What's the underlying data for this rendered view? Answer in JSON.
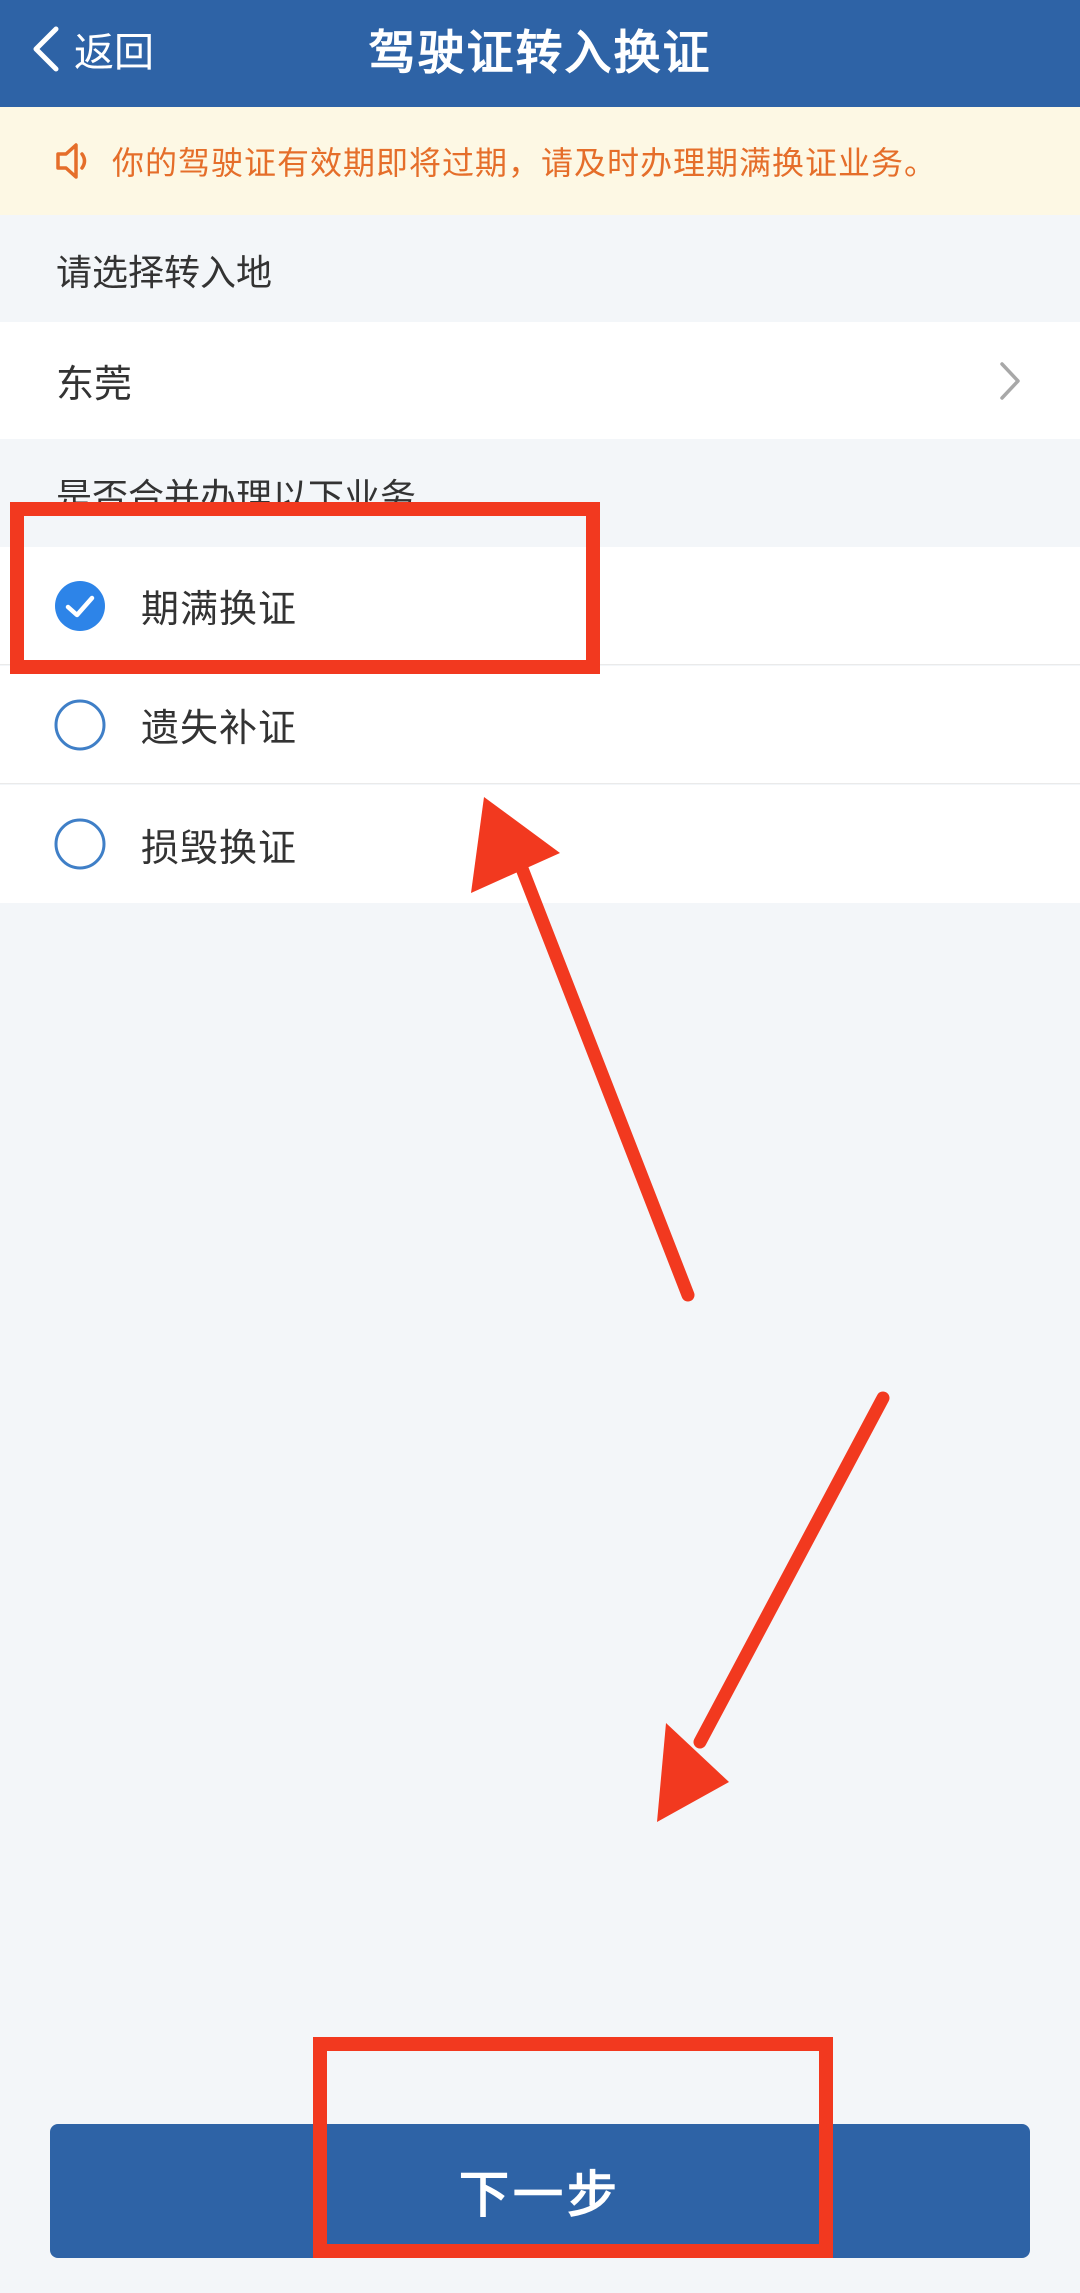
{
  "header": {
    "back_label": "返回",
    "title": "驾驶证转入换证"
  },
  "notice": {
    "icon": "speaker-icon",
    "text": "你的驾驶证有效期即将过期，请及时办理期满换证业务。"
  },
  "transfer": {
    "section_label": "请选择转入地",
    "selected_city": "东莞"
  },
  "services": {
    "section_label": "是否合并办理以下业务",
    "options": [
      {
        "label": "期满换证",
        "checked": true
      },
      {
        "label": "遗失补证",
        "checked": false
      },
      {
        "label": "损毁换证",
        "checked": false
      }
    ]
  },
  "next_button": {
    "label": "下一步"
  },
  "colors": {
    "brand": "#2e63a6",
    "notice_text": "#e56e2a",
    "notice_bg": "#fdf8e4",
    "check": "#2d84e8",
    "annotation": "#f2391f"
  }
}
